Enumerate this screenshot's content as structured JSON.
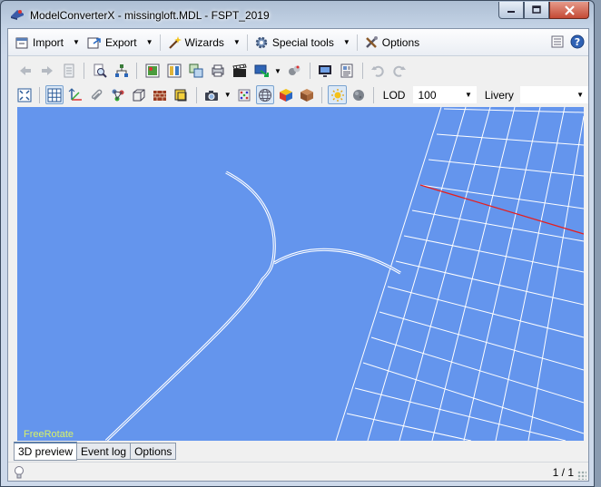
{
  "window": {
    "title": "ModelConverterX - missingloft.MDL - FSPT_2019",
    "buttons": [
      "minimize",
      "maximize",
      "close"
    ]
  },
  "menu": {
    "items": [
      {
        "label": "Import",
        "icon": "import-icon"
      },
      {
        "label": "Export",
        "icon": "export-icon"
      },
      {
        "label": "Wizards",
        "icon": "wand-icon"
      },
      {
        "label": "Special tools",
        "icon": "gear-icon"
      },
      {
        "label": "Options",
        "icon": "tools-icon"
      }
    ]
  },
  "toolbar2": {
    "lod_label": "LOD",
    "lod_value": "100",
    "livery_label": "Livery",
    "livery_value": ""
  },
  "viewport": {
    "background": "#6495ed",
    "mode_label": "FreeRotate"
  },
  "tabs": [
    {
      "label": "3D preview",
      "active": true
    },
    {
      "label": "Event log",
      "active": false
    },
    {
      "label": "Options",
      "active": false
    }
  ],
  "status": {
    "page": "1 / 1"
  }
}
